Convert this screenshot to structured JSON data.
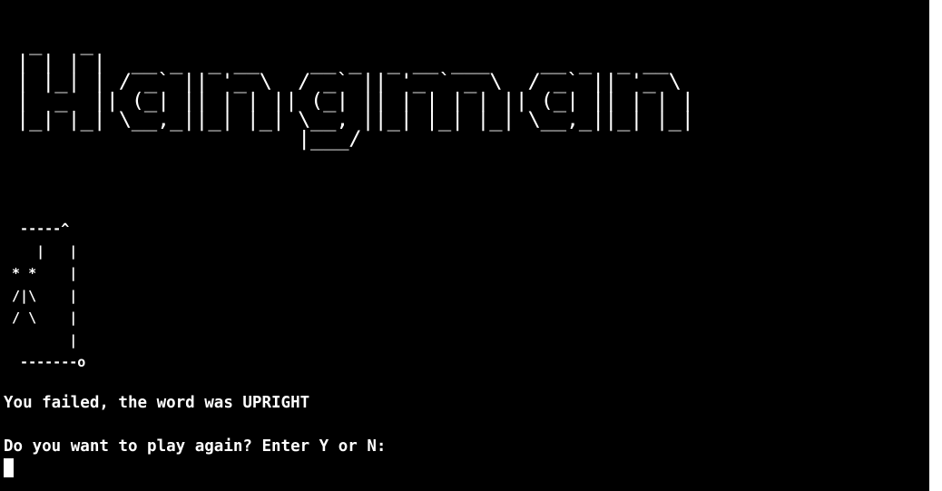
{
  "terminal": {
    "background": "#000000",
    "foreground": "#ffffff",
    "banner_ascii": " _   _\n| | | |  __ _  _ __    __ _  _ __ ___    __ _  _ __\n| |_| | / _` || '_ \\  / _` || '_ ` _ \\  / _` || '_ \\\n|  _  || (_| || | | || (_| || | | | | || (_| || | | |\n|_| |_| \\__,_||_| |_| \\__, ||_| |_| |_| \\__,_||_| |_|\n                      |___/",
    "gallows_ascii": "  -----^\n    |   |\n * *    |\n /|\\    |\n / \\    |\n        |\n  -------o",
    "result_text": "You failed, the word was UPRIGHT",
    "prompt_text": "Do you want to play again? Enter Y or N:"
  }
}
